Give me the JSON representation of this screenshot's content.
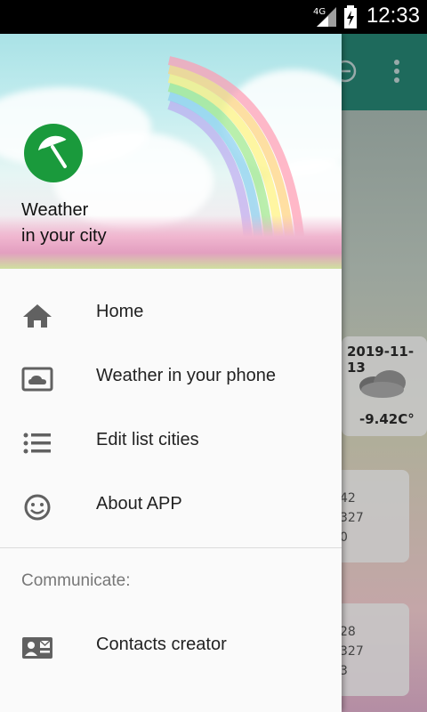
{
  "status_bar": {
    "network": "4G",
    "time": "12:33"
  },
  "background_app": {
    "forecast_card": {
      "date": "2019-11-13",
      "temp": "-9.42C°"
    },
    "card2": {
      "line1": "42",
      "line2": "327",
      "line3": "0"
    },
    "card3": {
      "line1": "28",
      "line2": "327",
      "line3": "3"
    }
  },
  "drawer": {
    "header": {
      "title_line1": "Weather",
      "title_line2": "in your city"
    },
    "items": [
      {
        "label": "Home",
        "icon": "home-icon"
      },
      {
        "label": "Weather in your phone",
        "icon": "cloud-screen-icon"
      },
      {
        "label": "Edit list cities",
        "icon": "list-icon"
      },
      {
        "label": "About APP",
        "icon": "smiley-icon"
      }
    ],
    "section_title": "Communicate:",
    "contact_item": {
      "label": "Contacts creator",
      "icon": "contact-card-icon"
    }
  },
  "colors": {
    "toolbar": "#1e6a5c",
    "logo": "#1a9a3c",
    "icon": "#616161"
  }
}
